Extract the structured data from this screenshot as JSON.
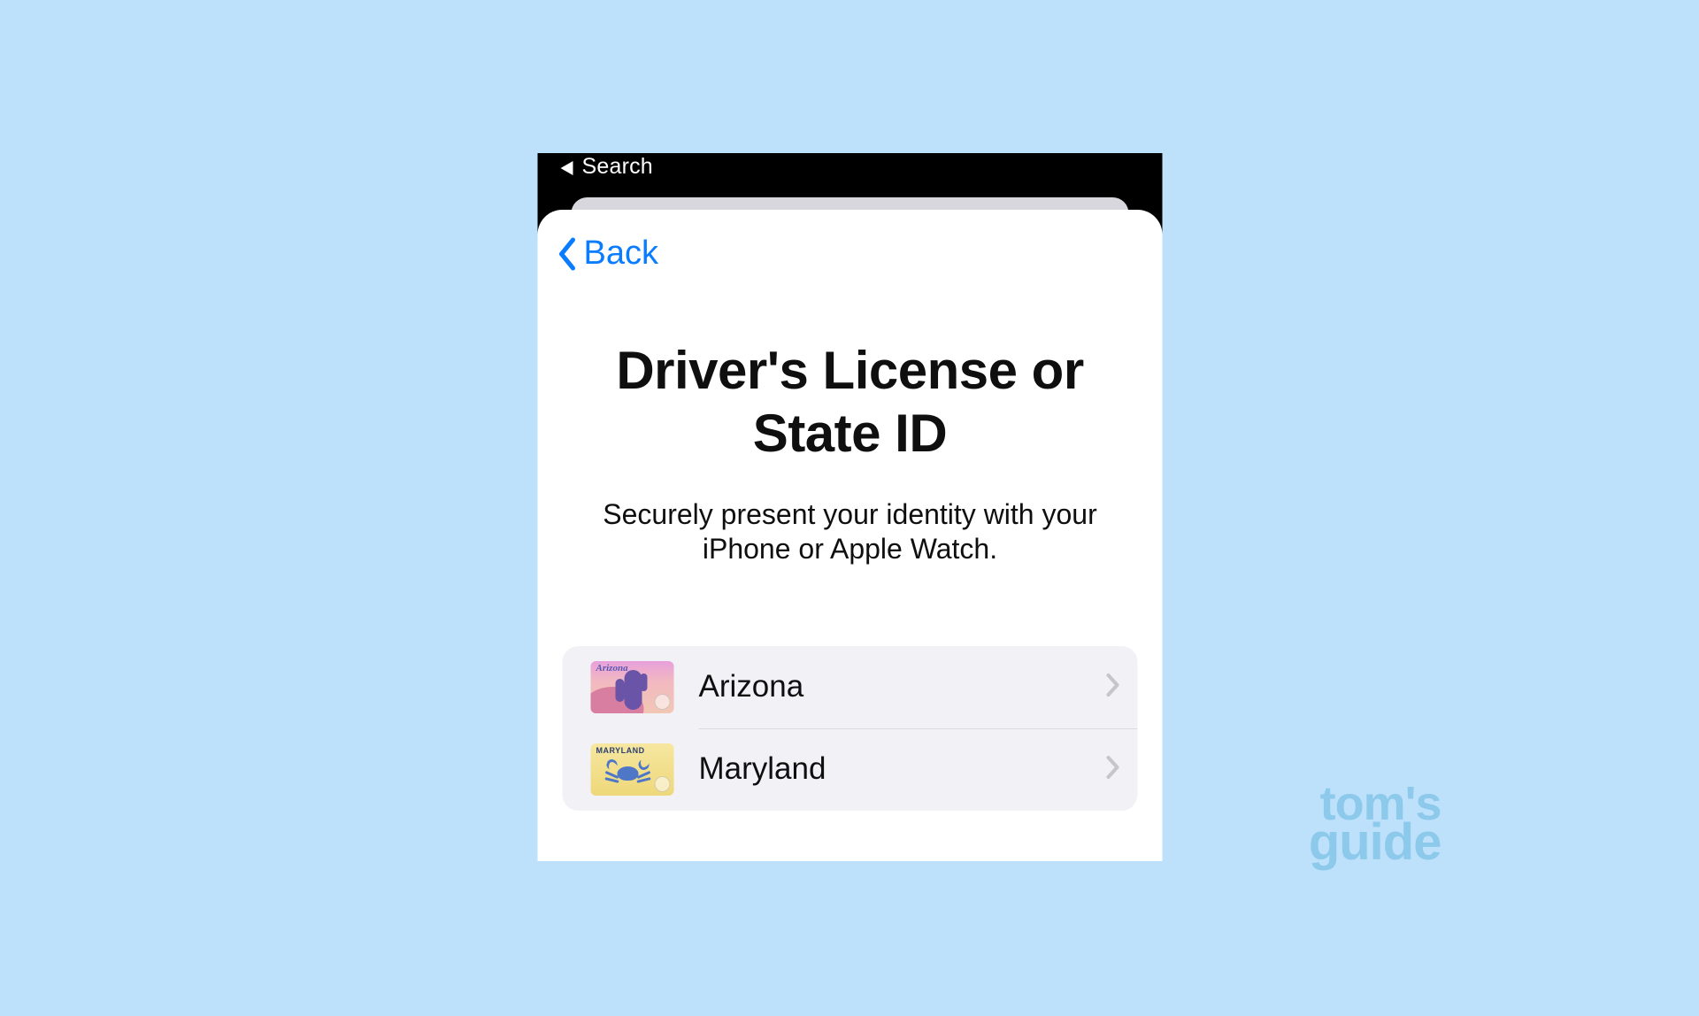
{
  "status": {
    "search_label": "Search"
  },
  "nav": {
    "back_label": "Back"
  },
  "header": {
    "title_line1": "Driver's License or",
    "title_line2": "State ID",
    "subtitle": "Securely present your identity with your iPhone or Apple Watch."
  },
  "states": [
    {
      "name": "Arizona",
      "thumb_label": "Arizona"
    },
    {
      "name": "Maryland",
      "thumb_label": "MARYLAND"
    }
  ],
  "watermark": {
    "line1": "tom's",
    "line2": "guide"
  }
}
